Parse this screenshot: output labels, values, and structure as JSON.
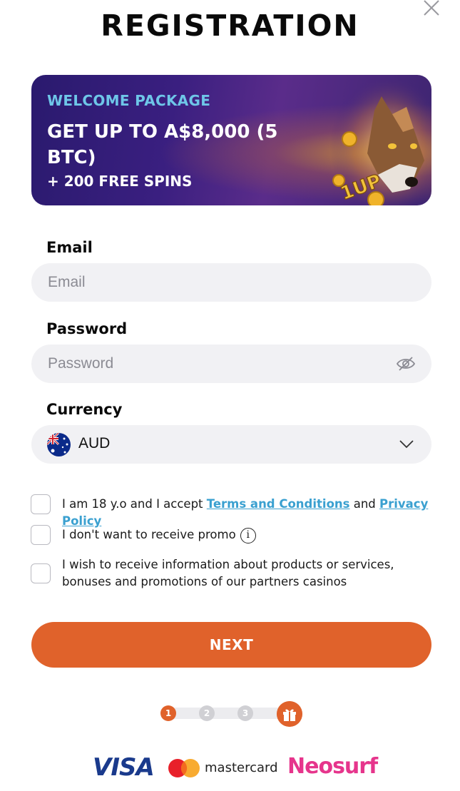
{
  "header": {
    "title": "REGISTRATION",
    "close_icon": "close-icon"
  },
  "banner": {
    "kicker": "WELCOME PACKAGE",
    "headline": "GET UP TO A$8,000 (5 BTC)",
    "subline": "+ 200 FREE SPINS",
    "kicker_color": "#6ec6e8"
  },
  "form": {
    "email": {
      "label": "Email",
      "placeholder": "Email",
      "value": ""
    },
    "password": {
      "label": "Password",
      "placeholder": "Password",
      "value": "",
      "toggle_icon": "eye-slash-icon"
    },
    "currency": {
      "label": "Currency",
      "value": "AUD",
      "flag_icon": "australia-flag-icon",
      "dropdown_icon": "chevron-down-icon"
    }
  },
  "consents": {
    "age": {
      "prefix": "I am 18 y.o and I accept ",
      "terms_link": "Terms and Conditions",
      "middle": " and ",
      "privacy_link": "Privacy Policy",
      "checked": false
    },
    "promo": {
      "text": "I don't want to receive promo",
      "info_icon": "info-icon",
      "info_glyph": "i",
      "checked": false
    },
    "partners": {
      "text": "I wish to receive information about products or services, bonuses and promotions of our partners casinos",
      "checked": false
    }
  },
  "actions": {
    "next_label": "NEXT",
    "accent": "#e0622b"
  },
  "progress": {
    "steps": [
      "1",
      "2",
      "3"
    ],
    "current": 1,
    "final_icon": "gift-icon"
  },
  "payments": {
    "visa": "VISA",
    "mastercard": "mastercard",
    "neosurf": "Neosurf"
  }
}
